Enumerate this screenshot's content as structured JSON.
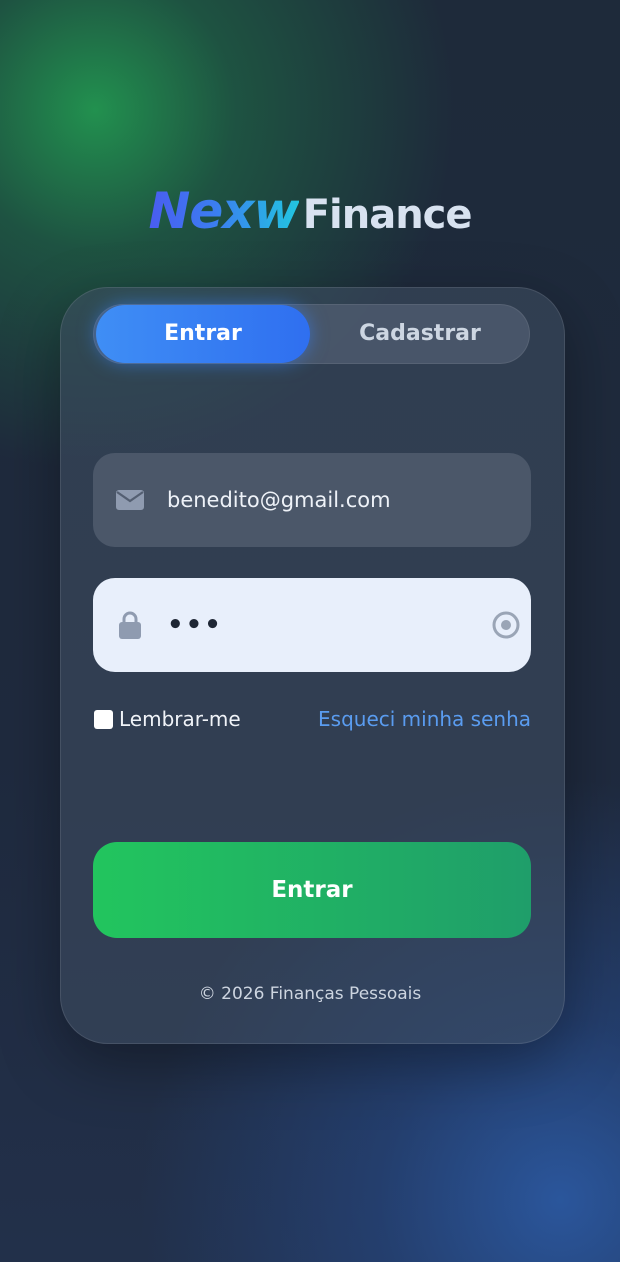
{
  "logo": {
    "brand": "Nexw",
    "suffix": "Finance"
  },
  "tabs": [
    {
      "label": "Entrar",
      "active": true
    },
    {
      "label": "Cadastrar",
      "active": false
    }
  ],
  "form": {
    "email": {
      "value": "benedito@gmail.com",
      "icon": "mail-icon"
    },
    "password": {
      "value": "•••",
      "icon": "lock-icon",
      "toggle_icon": "eye-icon"
    },
    "remember_label": "Lembrar-me",
    "forgot_label": "Esqueci minha senha",
    "submit_label": "Entrar"
  },
  "footer": {
    "text": "© 2026 Finanças Pessoais"
  },
  "colors": {
    "primary_tab": "#3b82f6",
    "submit": "#22c55e",
    "link": "#5a9cf0"
  }
}
